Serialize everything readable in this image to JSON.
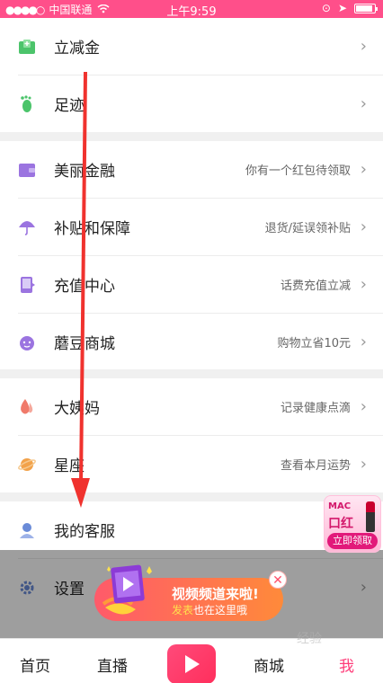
{
  "statusbar": {
    "carrier": "中国联通",
    "time": "上午9:59"
  },
  "sections": [
    {
      "items": [
        {
          "label": "立减金",
          "sub": "",
          "icon": "envelope-plus-icon",
          "color": "#4cc46b"
        },
        {
          "label": "足迹",
          "sub": "",
          "icon": "footprint-icon",
          "color": "#4cc46b"
        }
      ]
    },
    {
      "items": [
        {
          "label": "美丽金融",
          "sub": "你有一个红包待领取",
          "icon": "wallet-icon",
          "color": "#9b74e0"
        },
        {
          "label": "补贴和保障",
          "sub": "退货/延误领补贴",
          "icon": "umbrella-icon",
          "color": "#9b74e0"
        },
        {
          "label": "充值中心",
          "sub": "话费充值立减",
          "icon": "phone-icon",
          "color": "#9b74e0"
        },
        {
          "label": "蘑豆商城",
          "sub": "购物立省10元",
          "icon": "mushroom-icon",
          "color": "#9b74e0"
        }
      ]
    },
    {
      "items": [
        {
          "label": "大姨妈",
          "sub": "记录健康点滴",
          "icon": "drop-icon",
          "color": "#f07a6a"
        },
        {
          "label": "星座",
          "sub": "查看本月运势",
          "icon": "planet-icon",
          "color": "#f2a24a"
        }
      ]
    },
    {
      "items": [
        {
          "label": "我的客服",
          "sub": "",
          "icon": "customer-service-icon",
          "color": "#6a8bd8"
        },
        {
          "label": "设置",
          "sub": "",
          "icon": "gear-icon",
          "color": "#6a8bd8"
        }
      ]
    }
  ],
  "promo": {
    "title": "视频频道来啦!",
    "sub_highlight": "发表",
    "sub_rest": "也在这里哦"
  },
  "ad": {
    "brand": "MAC",
    "product": "口红",
    "button": "立即领取"
  },
  "tabbar": {
    "home": "首页",
    "live": "直播",
    "mall": "商城",
    "me": "我"
  },
  "watermark": "经验"
}
